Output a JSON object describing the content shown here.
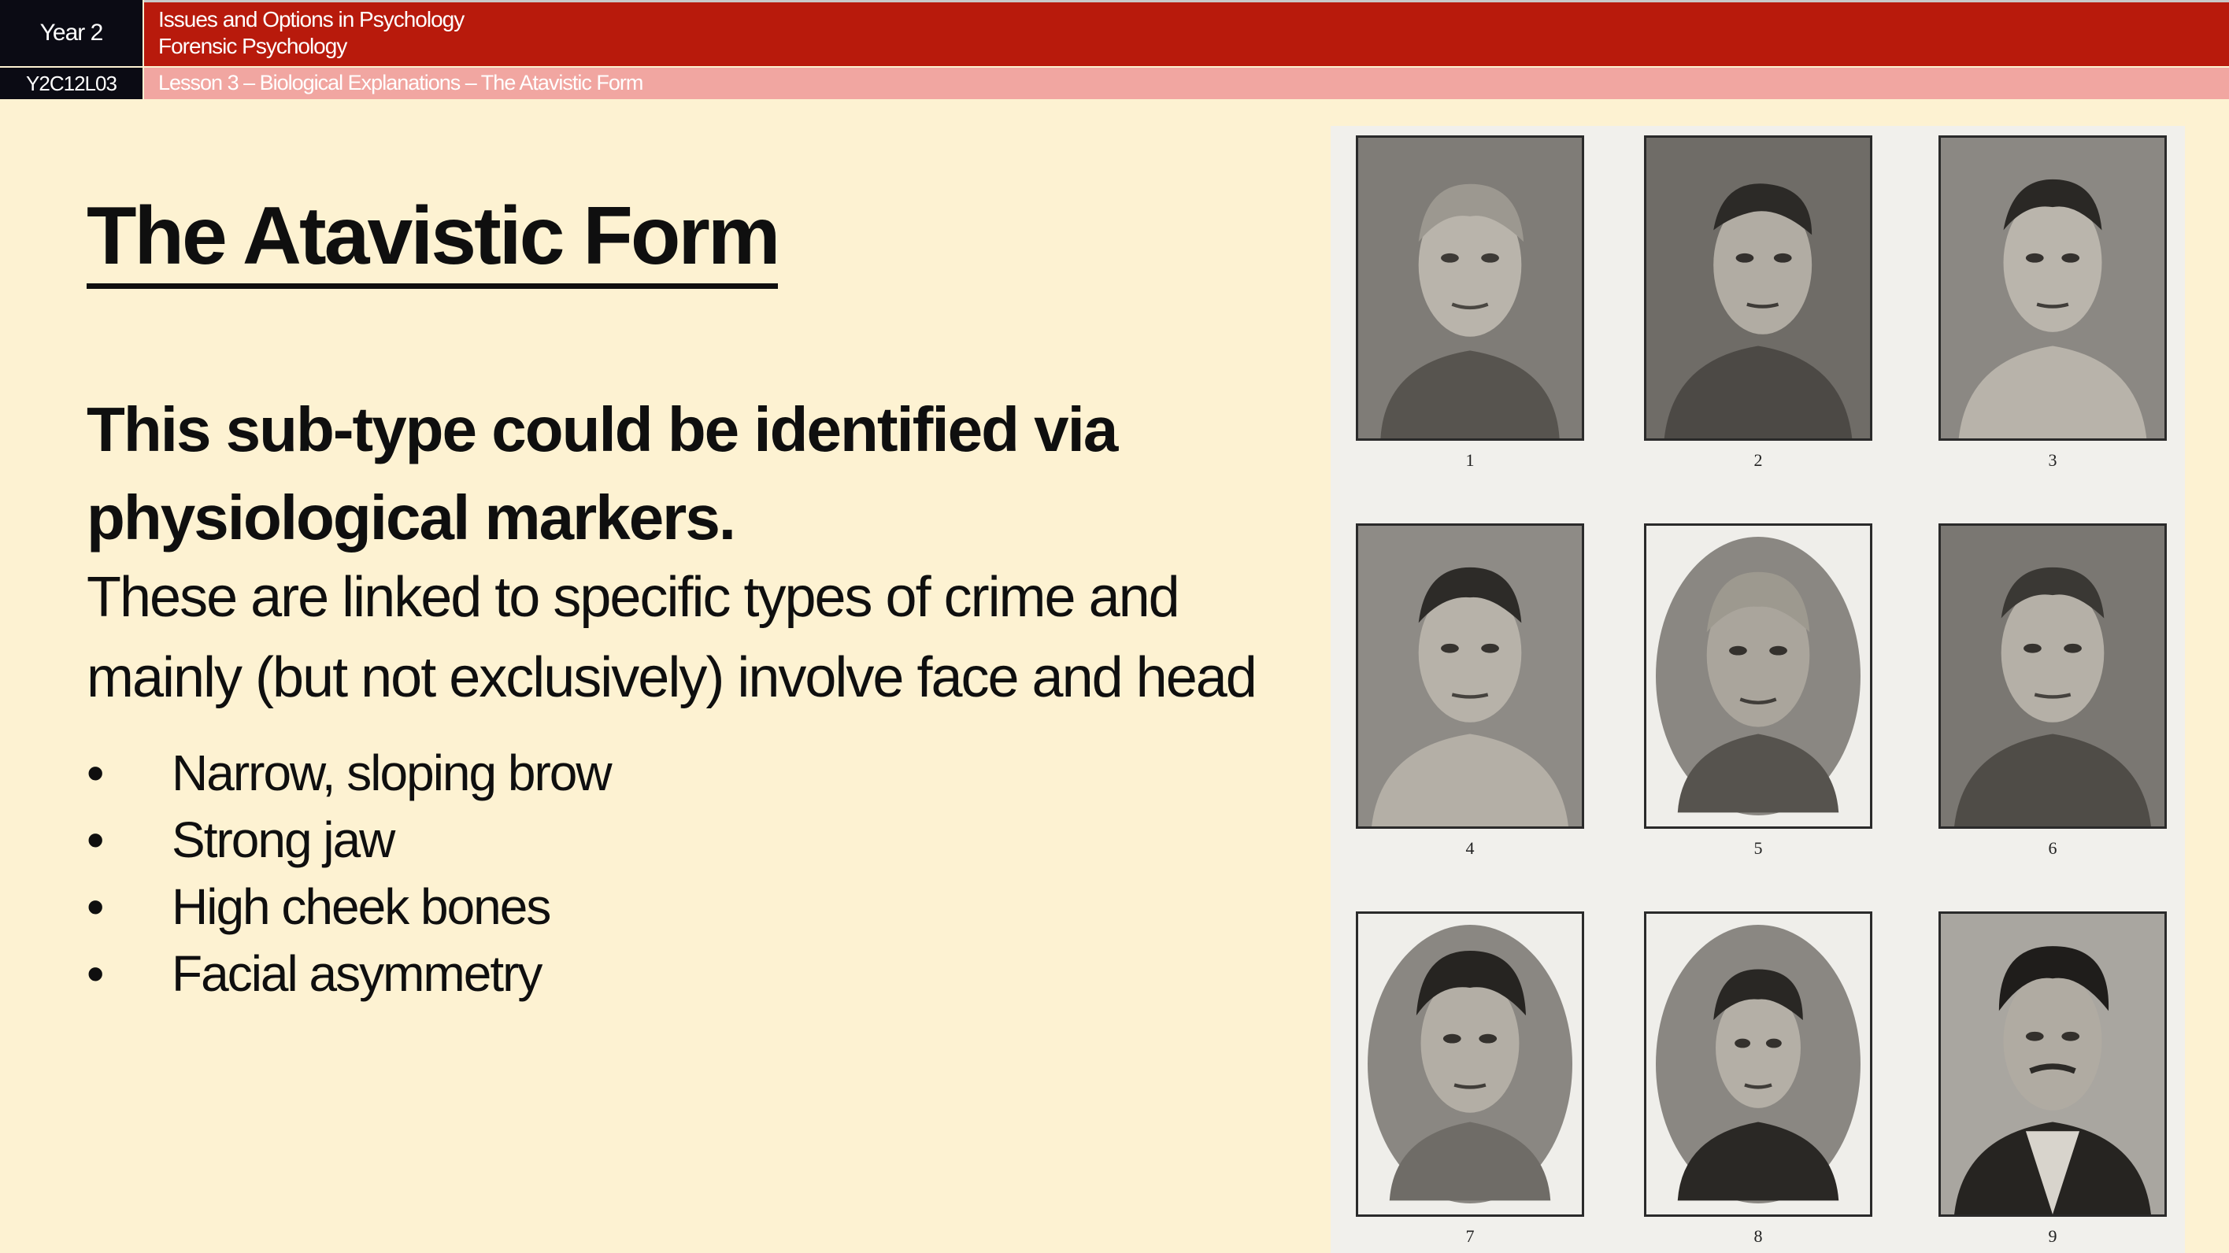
{
  "header": {
    "year_label": "Year 2",
    "code_label": "Y2C12L03",
    "course_line1": "Issues and Options in Psychology",
    "course_line2": "Forensic Psychology",
    "lesson_label": "Lesson 3 – Biological Explanations – The Atavistic Form"
  },
  "slide": {
    "title": "The Atavistic Form",
    "lead": "This sub-type could be identified via physiological markers.",
    "body": "These are linked to specific types of crime and mainly (but not exclusively) involve face and head",
    "bullets": [
      "Narrow, sloping brow",
      "Strong jaw",
      "High cheek bones",
      "Facial asymmetry"
    ]
  },
  "plate": {
    "captions": [
      "1",
      "2",
      "3",
      "4",
      "5",
      "6",
      "7",
      "8",
      "9"
    ]
  },
  "colors": {
    "background": "#fdf2d2",
    "header_red": "#b81a0c",
    "header_pink": "#f1a6a1",
    "header_dark": "#0b0b14"
  }
}
